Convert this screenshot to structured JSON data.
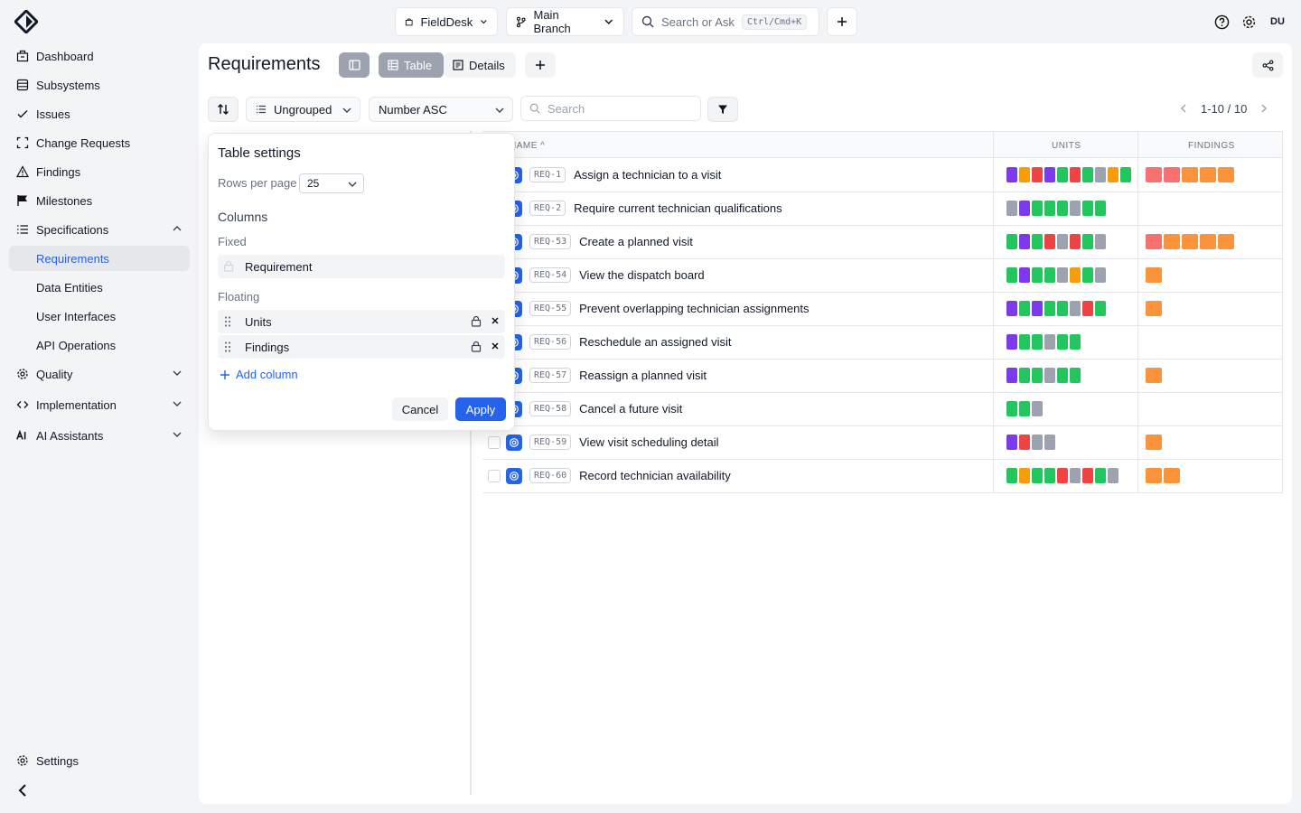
{
  "topbar": {
    "project": "FieldDesk",
    "branch": "Main Branch",
    "search_placeholder": "Search or Ask",
    "search_shortcut": "Ctrl/Cmd+K",
    "avatar": "DU"
  },
  "sidebar": {
    "items": [
      {
        "label": "Dashboard",
        "icon": "building-icon"
      },
      {
        "label": "Subsystems",
        "icon": "database-icon"
      },
      {
        "label": "Issues",
        "icon": "check-icon"
      },
      {
        "label": "Change Requests",
        "icon": "scan-icon"
      },
      {
        "label": "Findings",
        "icon": "warning-icon"
      },
      {
        "label": "Milestones",
        "icon": "flag-icon"
      },
      {
        "label": "Specifications",
        "icon": "list-icon"
      },
      {
        "label": "Requirements"
      },
      {
        "label": "Data Entities"
      },
      {
        "label": "User Interfaces"
      },
      {
        "label": "API Operations"
      },
      {
        "label": "Quality",
        "icon": "gear-icon"
      },
      {
        "label": "Implementation",
        "icon": "code-icon"
      },
      {
        "label": "AI Assistants",
        "icon": "ai-icon"
      }
    ],
    "settings": "Settings"
  },
  "page": {
    "title": "Requirements",
    "view_table": "Table",
    "view_details": "Details"
  },
  "toolbar": {
    "grouping": "Ungrouped",
    "sort": "Number ASC",
    "search_placeholder": "Search",
    "pagination": "1-10 / 10"
  },
  "table": {
    "headers": {
      "name": "NAME",
      "units": "UNITS",
      "findings": "FINDINGS"
    },
    "rows": [
      {
        "id": "REQ-1",
        "title": "Assign a technician to a visit",
        "units": [
          "purple",
          "orange",
          "red",
          "purple",
          "green",
          "red",
          "green",
          "gray",
          "orange",
          "green"
        ],
        "findings": [
          "salmon",
          "salmon",
          "orange",
          "orange",
          "orange"
        ]
      },
      {
        "id": "REQ-2",
        "title": "Require current technician qualifications",
        "units": [
          "gray",
          "purple",
          "green",
          "green",
          "green",
          "gray",
          "green",
          "green"
        ],
        "findings": []
      },
      {
        "id": "REQ-53",
        "title": "Create a planned visit",
        "units": [
          "green",
          "purple",
          "green",
          "red",
          "gray",
          "red",
          "green",
          "gray"
        ],
        "findings": [
          "salmon",
          "orange",
          "orange",
          "orange",
          "orange"
        ]
      },
      {
        "id": "REQ-54",
        "title": "View the dispatch board",
        "units": [
          "green",
          "purple",
          "green",
          "green",
          "gray",
          "orange",
          "green",
          "gray"
        ],
        "findings": [
          "orange"
        ]
      },
      {
        "id": "REQ-55",
        "title": "Prevent overlapping technician assignments",
        "units": [
          "purple",
          "green",
          "purple",
          "green",
          "green",
          "gray",
          "red",
          "green"
        ],
        "findings": [
          "orange"
        ]
      },
      {
        "id": "REQ-56",
        "title": "Reschedule an assigned visit",
        "units": [
          "purple",
          "green",
          "green",
          "gray",
          "green",
          "green"
        ],
        "findings": []
      },
      {
        "id": "REQ-57",
        "title": "Reassign a planned visit",
        "units": [
          "purple",
          "green",
          "green",
          "gray",
          "green",
          "green"
        ],
        "findings": [
          "orange"
        ]
      },
      {
        "id": "REQ-58",
        "title": "Cancel a future visit",
        "units": [
          "green",
          "green",
          "gray"
        ],
        "findings": []
      },
      {
        "id": "REQ-59",
        "title": "View visit scheduling detail",
        "units": [
          "purple",
          "red",
          "gray",
          "gray"
        ],
        "findings": [
          "orange"
        ]
      },
      {
        "id": "REQ-60",
        "title": "Record technician availability",
        "units": [
          "green",
          "orange",
          "green",
          "green",
          "red",
          "gray",
          "red",
          "green",
          "gray"
        ],
        "findings": [
          "orange",
          "orange"
        ]
      }
    ]
  },
  "table_settings": {
    "title": "Table settings",
    "rows_per_page_label": "Rows per page",
    "rows_per_page": "25",
    "columns_label": "Columns",
    "fixed_label": "Fixed",
    "fixed_columns": [
      "Requirement"
    ],
    "floating_label": "Floating",
    "floating_columns": [
      "Units",
      "Findings"
    ],
    "add_column": "Add column",
    "cancel": "Cancel",
    "apply": "Apply"
  },
  "colors": {
    "purple": "#7c3aed",
    "orange": "#f59e0b",
    "red": "#ef4444",
    "green": "#22c55e",
    "gray": "#9ca3af",
    "salmon": "#f87171",
    "findings_orange": "#fb923c",
    "accent": "#2563eb"
  }
}
